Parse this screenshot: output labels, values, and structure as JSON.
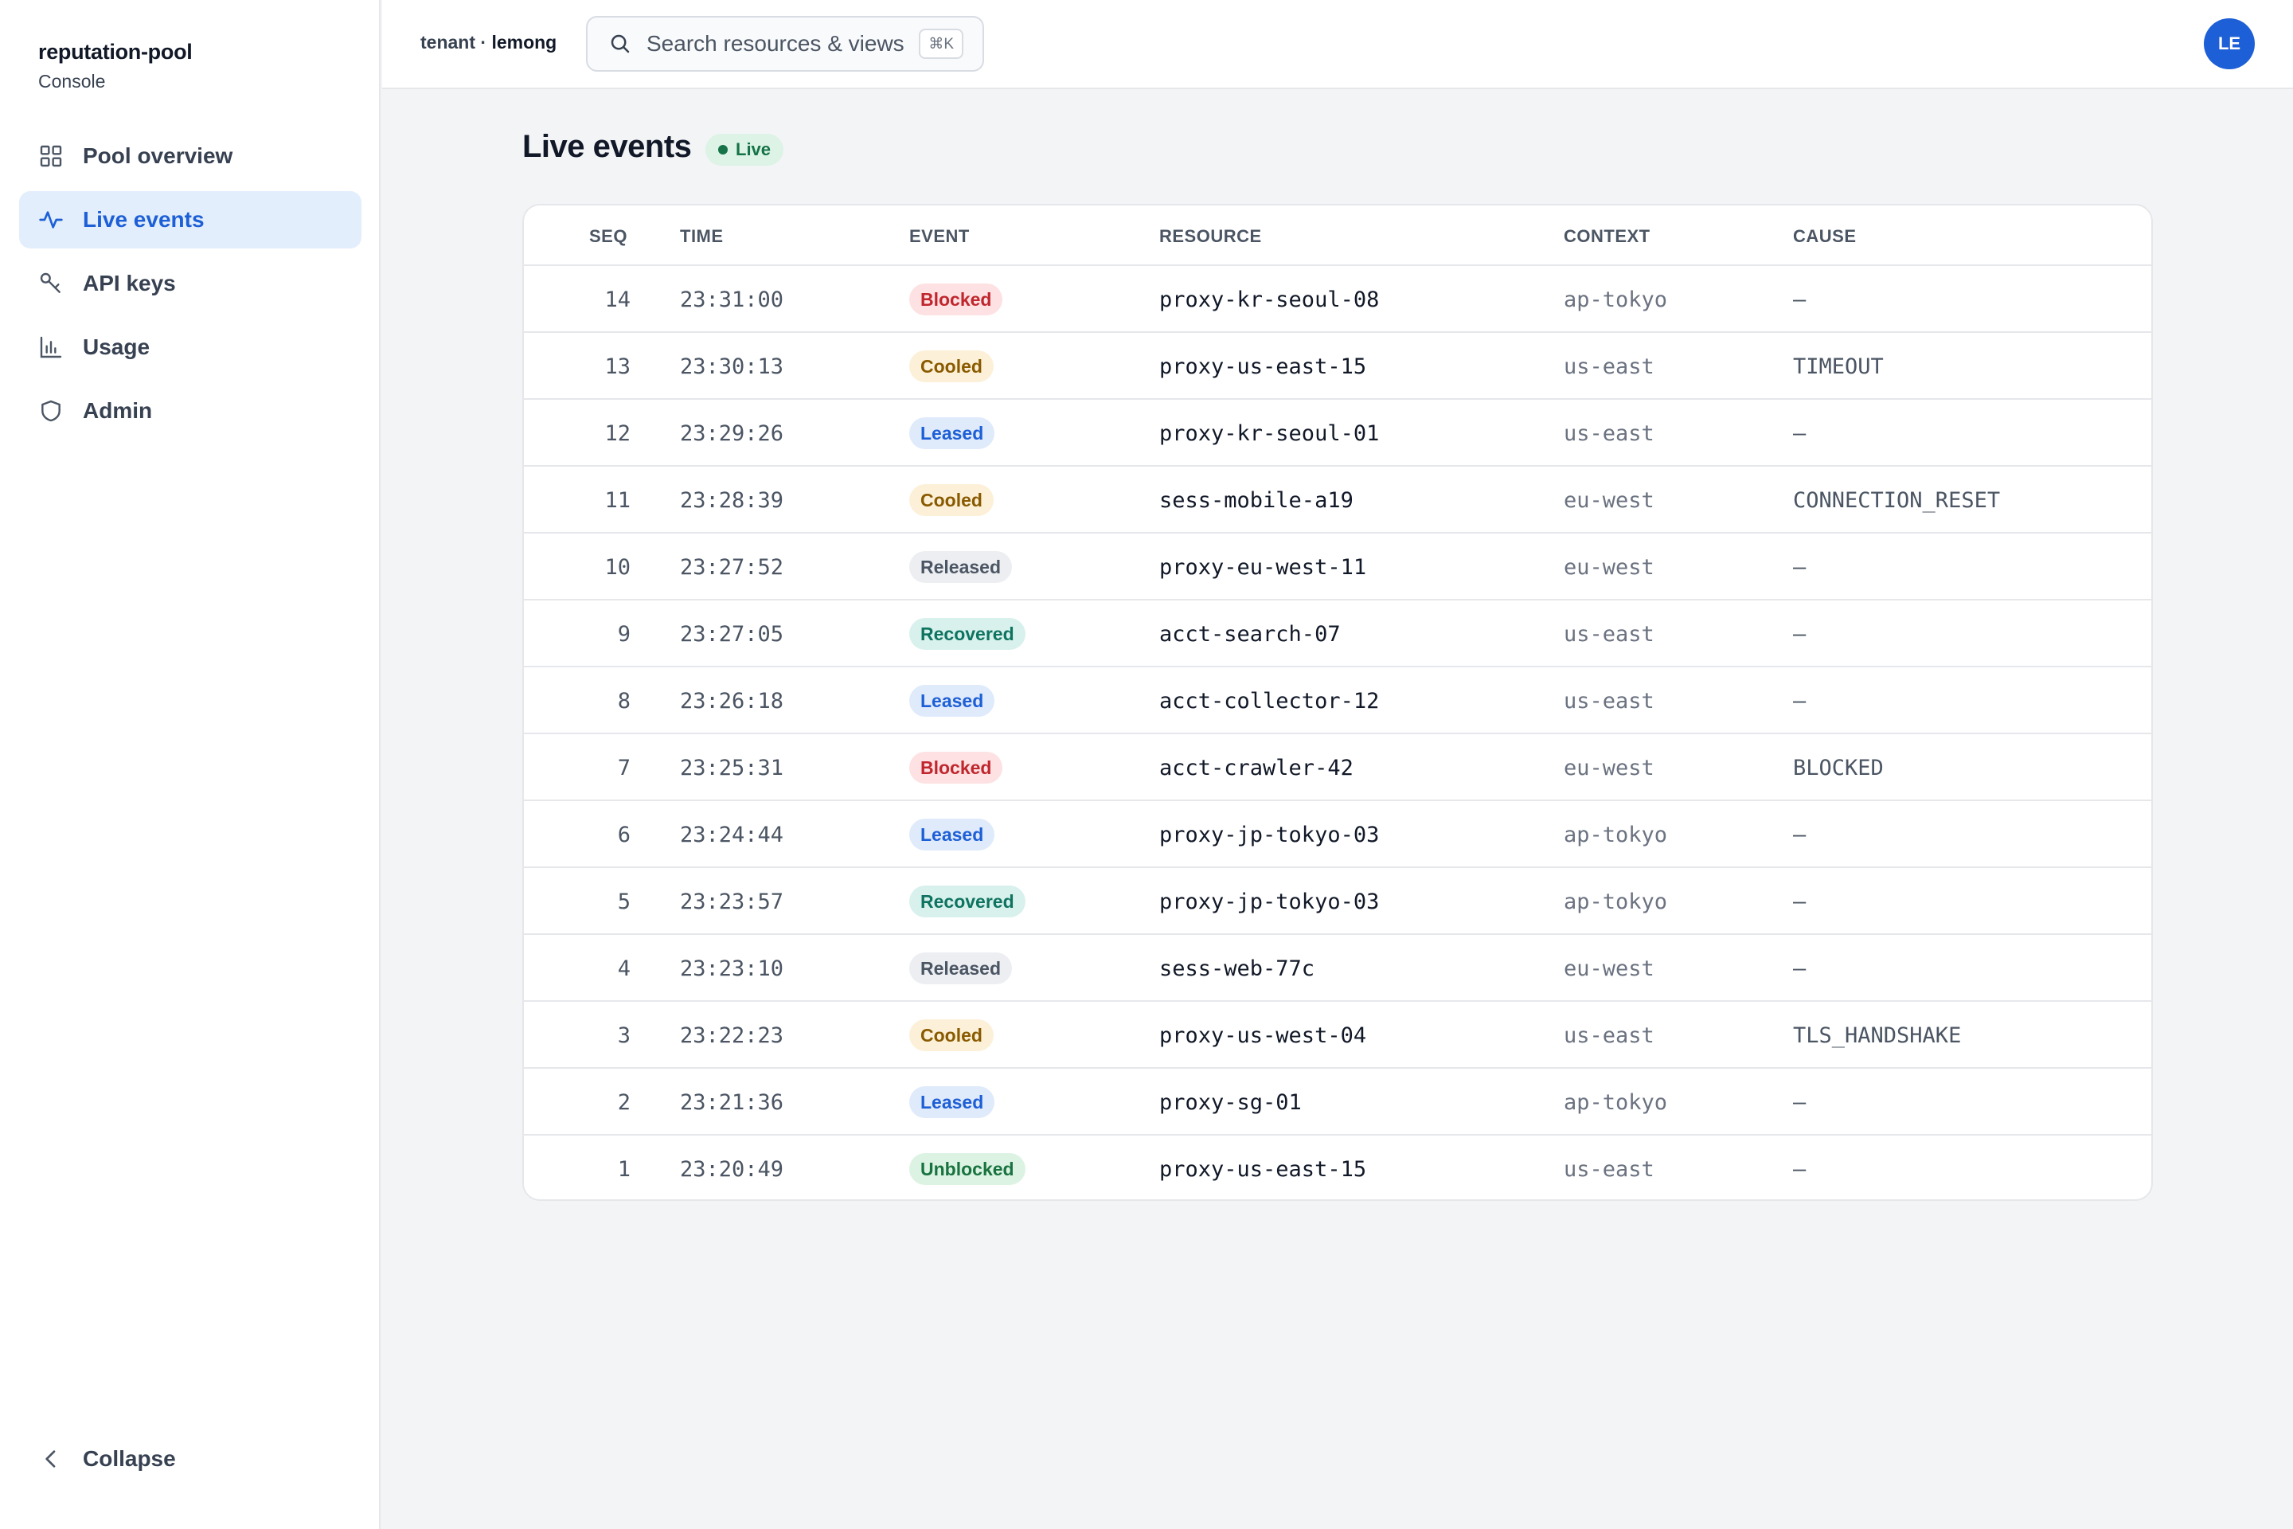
{
  "sidebar": {
    "brand": "reputation-pool",
    "subtitle": "Console",
    "items": [
      {
        "label": "Pool overview",
        "icon": "grid-icon"
      },
      {
        "label": "Live events",
        "icon": "activity-icon",
        "active": true
      },
      {
        "label": "API keys",
        "icon": "key-icon"
      },
      {
        "label": "Usage",
        "icon": "bar-chart-icon"
      },
      {
        "label": "Admin",
        "icon": "shield-icon"
      }
    ],
    "collapse_label": "Collapse"
  },
  "topbar": {
    "tenant_prefix": "tenant · ",
    "tenant_name": "lemong",
    "search_placeholder": "Search resources & views",
    "shortcut": "⌘K",
    "avatar_initials": "LE"
  },
  "main": {
    "title": "Live events",
    "live_label": "Live",
    "columns": [
      "SEQ",
      "TIME",
      "EVENT",
      "RESOURCE",
      "CONTEXT",
      "CAUSE"
    ],
    "rows": [
      {
        "seq": "14",
        "time": "23:31:00",
        "event": "Blocked",
        "resource": "proxy-kr-seoul-08",
        "context": "ap-tokyo",
        "cause": "—"
      },
      {
        "seq": "13",
        "time": "23:30:13",
        "event": "Cooled",
        "resource": "proxy-us-east-15",
        "context": "us-east",
        "cause": "TIMEOUT"
      },
      {
        "seq": "12",
        "time": "23:29:26",
        "event": "Leased",
        "resource": "proxy-kr-seoul-01",
        "context": "us-east",
        "cause": "—"
      },
      {
        "seq": "11",
        "time": "23:28:39",
        "event": "Cooled",
        "resource": "sess-mobile-a19",
        "context": "eu-west",
        "cause": "CONNECTION_RESET"
      },
      {
        "seq": "10",
        "time": "23:27:52",
        "event": "Released",
        "resource": "proxy-eu-west-11",
        "context": "eu-west",
        "cause": "—"
      },
      {
        "seq": "9",
        "time": "23:27:05",
        "event": "Recovered",
        "resource": "acct-search-07",
        "context": "us-east",
        "cause": "—"
      },
      {
        "seq": "8",
        "time": "23:26:18",
        "event": "Leased",
        "resource": "acct-collector-12",
        "context": "us-east",
        "cause": "—"
      },
      {
        "seq": "7",
        "time": "23:25:31",
        "event": "Blocked",
        "resource": "acct-crawler-42",
        "context": "eu-west",
        "cause": "BLOCKED"
      },
      {
        "seq": "6",
        "time": "23:24:44",
        "event": "Leased",
        "resource": "proxy-jp-tokyo-03",
        "context": "ap-tokyo",
        "cause": "—"
      },
      {
        "seq": "5",
        "time": "23:23:57",
        "event": "Recovered",
        "resource": "proxy-jp-tokyo-03",
        "context": "ap-tokyo",
        "cause": "—"
      },
      {
        "seq": "4",
        "time": "23:23:10",
        "event": "Released",
        "resource": "sess-web-77c",
        "context": "eu-west",
        "cause": "—"
      },
      {
        "seq": "3",
        "time": "23:22:23",
        "event": "Cooled",
        "resource": "proxy-us-west-04",
        "context": "us-east",
        "cause": "TLS_HANDSHAKE"
      },
      {
        "seq": "2",
        "time": "23:21:36",
        "event": "Leased",
        "resource": "proxy-sg-01",
        "context": "ap-tokyo",
        "cause": "—"
      },
      {
        "seq": "1",
        "time": "23:20:49",
        "event": "Unblocked",
        "resource": "proxy-us-east-15",
        "context": "us-east",
        "cause": "—"
      }
    ]
  },
  "colors": {
    "accent": "#1d5fd6",
    "active_nav_bg": "#e3eefc",
    "live_green": "#157347"
  }
}
